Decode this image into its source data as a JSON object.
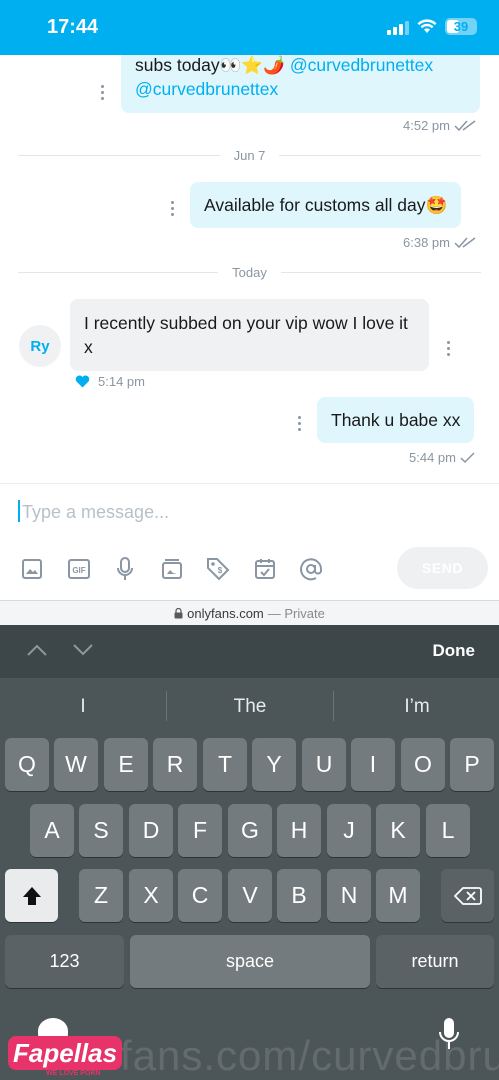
{
  "status": {
    "time": "17:44",
    "battery": "39"
  },
  "messages": {
    "m1": {
      "text_start": "subs today",
      "emoji": "👀⭐🌶️",
      "mention1": "@curvedbrunettex",
      "mention2": "@curvedbrunettex",
      "time": "4:52 pm"
    },
    "date1": "Jun 7",
    "m2": {
      "text": "Available for customs all day",
      "emoji": "🤩",
      "time": "6:38 pm"
    },
    "date2": "Today",
    "m3": {
      "avatar": "Ry",
      "text": "I recently subbed on your vip wow I love it x",
      "time": "5:14 pm"
    },
    "m4": {
      "text": "Thank u babe xx",
      "time": "5:44 pm"
    }
  },
  "composer": {
    "placeholder": "Type a message...",
    "send_label": "SEND",
    "tools": [
      "image-icon",
      "gif-icon",
      "microphone-icon",
      "vault-icon",
      "price-tag-icon",
      "schedule-icon",
      "mention-icon"
    ]
  },
  "url_bar": {
    "domain": "onlyfans.com",
    "private": "— Private"
  },
  "keyboard": {
    "done_label": "Done",
    "suggestions": [
      "I",
      "The",
      "I’m"
    ],
    "row1": [
      "Q",
      "W",
      "E",
      "R",
      "T",
      "Y",
      "U",
      "I",
      "O",
      "P"
    ],
    "row2": [
      "A",
      "S",
      "D",
      "F",
      "G",
      "H",
      "J",
      "K",
      "L"
    ],
    "row3": [
      "Z",
      "X",
      "C",
      "V",
      "B",
      "N",
      "M"
    ],
    "numbers_label": "123",
    "space_label": "space",
    "return_label": "return"
  },
  "overlay": {
    "watermark": "fans.com/curvedbrun",
    "brand_name": "Fapellas",
    "brand_tag": "WE LOVE PORN"
  }
}
